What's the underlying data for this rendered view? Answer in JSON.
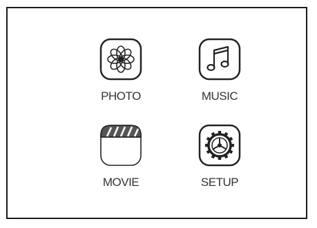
{
  "menu": {
    "items": [
      {
        "id": "photo",
        "label": "PHOTO",
        "icon": "flower-icon"
      },
      {
        "id": "music",
        "label": "MUSIC",
        "icon": "music-note-icon"
      },
      {
        "id": "movie",
        "label": "MOVIE",
        "icon": "clapperboard-icon"
      },
      {
        "id": "setup",
        "label": "SETUP",
        "icon": "gear-icon"
      }
    ]
  },
  "colors": {
    "frame": "#1a1a1a",
    "icon_stroke": "#222222",
    "label_text": "#333333",
    "background": "#ffffff"
  }
}
